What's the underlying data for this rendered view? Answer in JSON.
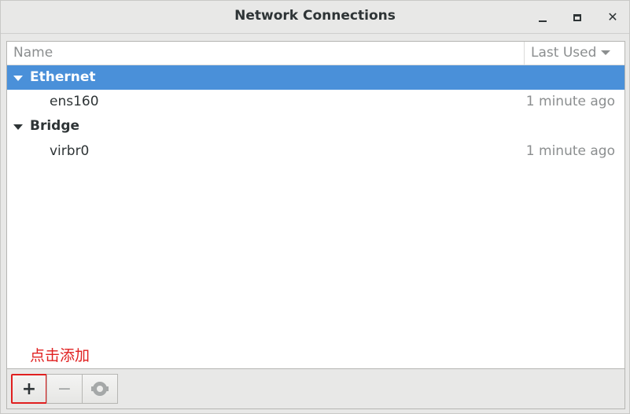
{
  "window": {
    "title": "Network Connections"
  },
  "columns": {
    "name": "Name",
    "last_used": "Last Used"
  },
  "groups": [
    {
      "label": "Ethernet",
      "selected": true,
      "connections": [
        {
          "name": "ens160",
          "last_used": "1 minute ago"
        }
      ]
    },
    {
      "label": "Bridge",
      "selected": false,
      "connections": [
        {
          "name": "virbr0",
          "last_used": "1 minute ago"
        }
      ]
    }
  ],
  "annotation": {
    "text": "点击添加",
    "color": "#e02020"
  },
  "toolbar": {
    "add_label": "+",
    "remove_label": "−",
    "settings_icon": "gear-icon"
  },
  "colors": {
    "selection": "#4a90d9",
    "highlight_border": "#e02020"
  }
}
